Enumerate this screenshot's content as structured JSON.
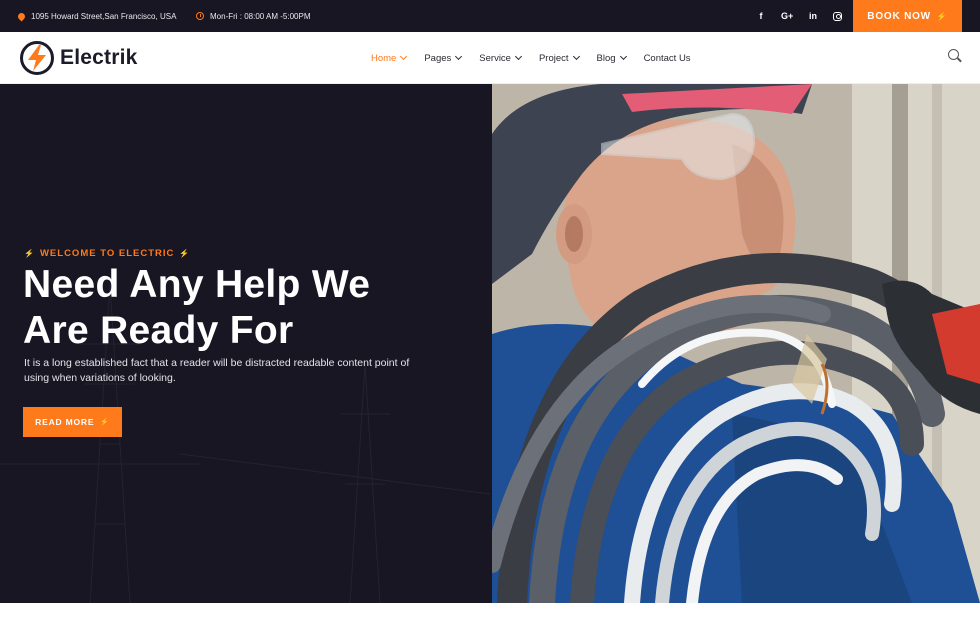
{
  "topbar": {
    "address": "1095 Howard Street,San Francisco, USA",
    "hours": "Mon-Fri : 08:00 AM -5:00PM",
    "socials": [
      "f",
      "G+",
      "in",
      "instagram"
    ],
    "book_label": "BOOK NOW",
    "bolt": "⚡"
  },
  "header": {
    "logo_text": "Electrik",
    "nav": [
      {
        "label": "Home",
        "active": true
      },
      {
        "label": "Pages"
      },
      {
        "label": "Service"
      },
      {
        "label": "Project"
      },
      {
        "label": "Blog"
      },
      {
        "label": "Contact Us"
      }
    ]
  },
  "hero": {
    "welcome": "WELCOME TO ELECTRIC",
    "title_line1": "Need Any Help We",
    "title_line2": "Are Ready For",
    "description": "It is a long established fact that a reader will be distracted readable content point of using when variations of looking.",
    "button_label": "READ MORE"
  },
  "colors": {
    "accent": "#ff7a1a",
    "dark": "#171622"
  }
}
